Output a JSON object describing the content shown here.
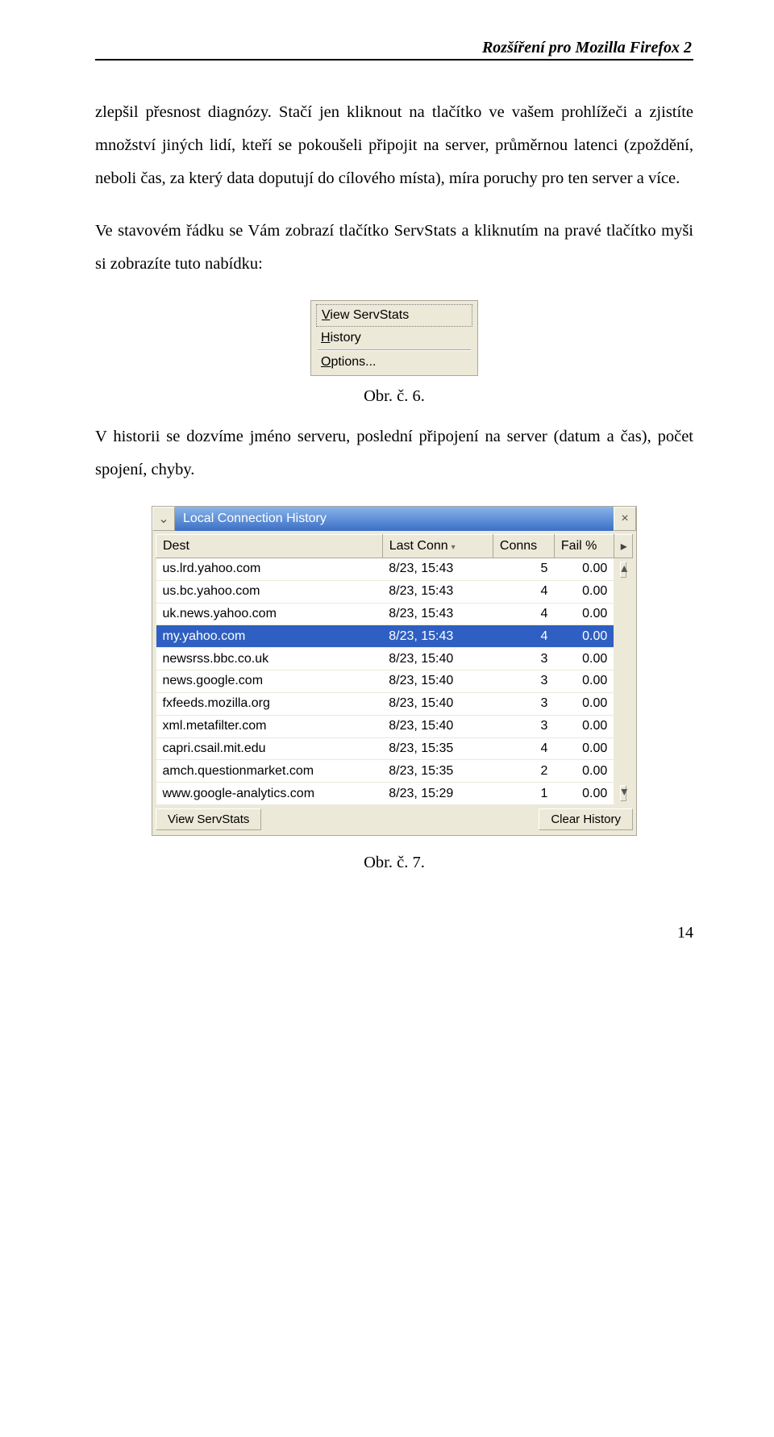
{
  "header": {
    "title": "Rozšíření pro Mozilla Firefox 2"
  },
  "paragraphs": {
    "p1": "zlepšil přesnost diagnózy. Stačí jen kliknout na tlačítko ve vašem prohlížeči a zjistíte množství jiných lidí, kteří se pokoušeli připojit na server, průměrnou latenci (zpoždění, neboli čas, za který data doputují do cílového místa), míra poruchy pro ten server a více.",
    "p2": "Ve stavovém řádku se Vám zobrazí tlačítko ServStats a kliknutím na pravé tlačítko myši si zobrazíte tuto nabídku:"
  },
  "menu": {
    "items": [
      {
        "label": "View ServStats",
        "head": true,
        "under": true
      },
      {
        "label": "History",
        "under": true
      },
      {
        "sep": true
      },
      {
        "label": "Options...",
        "under": true
      }
    ]
  },
  "captions": {
    "fig6": "Obr. č. 6.",
    "fig7": "Obr. č. 7."
  },
  "paragraphs2": {
    "p3": "V historii se dozvíme jméno serveru, poslední připojení na server (datum a čas), počet spojení, chyby."
  },
  "history": {
    "title": "Local Connection History",
    "expand_glyph": "⌄",
    "close_glyph": "×",
    "opts_glyph": "▸",
    "headers": {
      "dest": "Dest",
      "last": "Last Conn",
      "conns": "Conns",
      "fail": "Fail %"
    },
    "sort_ind": "▾",
    "rows": [
      {
        "dest": "us.lrd.yahoo.com",
        "last": "8/23, 15:43",
        "conns": "5",
        "fail": "0.00"
      },
      {
        "dest": "us.bc.yahoo.com",
        "last": "8/23, 15:43",
        "conns": "4",
        "fail": "0.00"
      },
      {
        "dest": "uk.news.yahoo.com",
        "last": "8/23, 15:43",
        "conns": "4",
        "fail": "0.00"
      },
      {
        "dest": "my.yahoo.com",
        "last": "8/23, 15:43",
        "conns": "4",
        "fail": "0.00",
        "selected": true
      },
      {
        "dest": "newsrss.bbc.co.uk",
        "last": "8/23, 15:40",
        "conns": "3",
        "fail": "0.00"
      },
      {
        "dest": "news.google.com",
        "last": "8/23, 15:40",
        "conns": "3",
        "fail": "0.00"
      },
      {
        "dest": "fxfeeds.mozilla.org",
        "last": "8/23, 15:40",
        "conns": "3",
        "fail": "0.00"
      },
      {
        "dest": "xml.metafilter.com",
        "last": "8/23, 15:40",
        "conns": "3",
        "fail": "0.00"
      },
      {
        "dest": "capri.csail.mit.edu",
        "last": "8/23, 15:35",
        "conns": "4",
        "fail": "0.00"
      },
      {
        "dest": "amch.questionmarket.com",
        "last": "8/23, 15:35",
        "conns": "2",
        "fail": "0.00"
      },
      {
        "dest": "www.google-analytics.com",
        "last": "8/23, 15:29",
        "conns": "1",
        "fail": "0.00"
      }
    ],
    "scroll_up": "▴",
    "scroll_dn": "▾",
    "footer": {
      "view": "View ServStats",
      "clear": "Clear History"
    }
  },
  "page_number": "14"
}
